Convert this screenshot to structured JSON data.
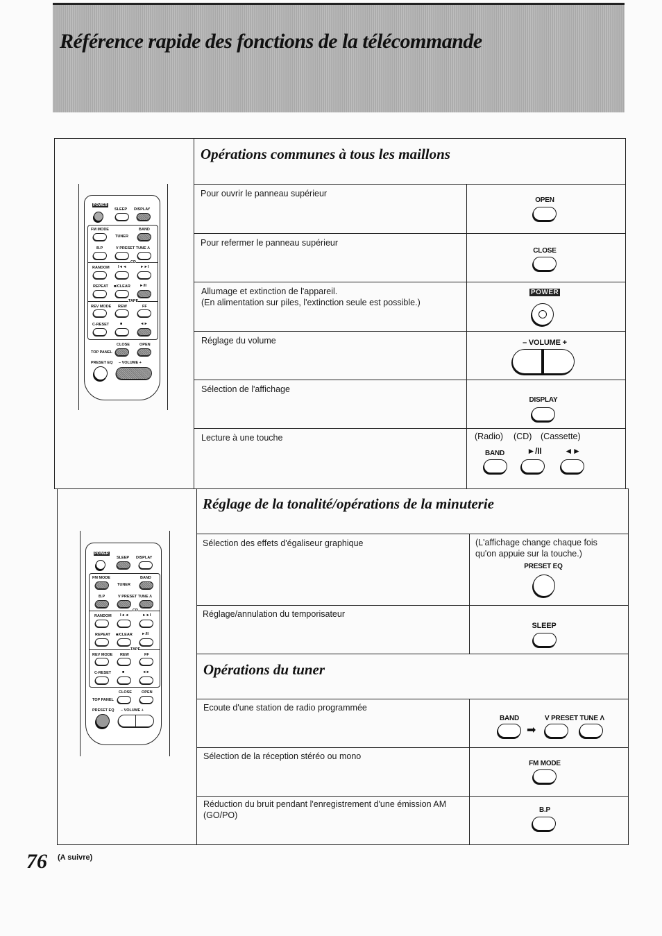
{
  "page_title": "Référence rapide des fonctions de la télécommande",
  "page_number": "76",
  "continued_label": "(A suivre)",
  "remote": {
    "power": "POWER",
    "sleep": "SLEEP",
    "display": "DISPLAY",
    "fm_mode": "FM MODE",
    "band": "BAND",
    "tuner": "TUNER",
    "bp": "B.P",
    "preset_tune": "V PRESET TUNE Λ",
    "cd": "CD",
    "random": "RANDOM",
    "prev": "I◄◄",
    "next": "►►I",
    "repeat": "REPEAT",
    "stop_clear": "■/CLEAR",
    "play_pause": "►/II",
    "tape": "TAPE",
    "rev_mode": "REV MODE",
    "rew": "REW",
    "ff": "FF",
    "c_reset": "C-RESET",
    "stop": "■",
    "tape_play": "◄►",
    "close": "CLOSE",
    "open": "OPEN",
    "top_panel": "TOP PANEL",
    "preset_eq": "PRESET EQ",
    "volume": "– VOLUME +"
  },
  "sections": [
    {
      "title": "Opérations communes à tous les maillons",
      "rows": [
        {
          "description": "Pour ouvrir le panneau supérieur",
          "buttons": [
            "OPEN"
          ]
        },
        {
          "description": "Pour refermer le panneau supérieur",
          "buttons": [
            "CLOSE"
          ]
        },
        {
          "description": "Allumage et extinction de l'appareil.",
          "description2": "(En alimentation sur piles, l'extinction seule est possible.)",
          "buttons": [
            "POWER"
          ]
        },
        {
          "description": "Réglage du volume",
          "buttons": [
            "– VOLUME +"
          ]
        },
        {
          "description": "Sélection de l'affichage",
          "buttons": [
            "DISPLAY"
          ]
        },
        {
          "description": "Lecture à une touche",
          "modes": [
            "(Radio)",
            "(CD)",
            "(Cassette)"
          ],
          "buttons": [
            "BAND",
            "►/II",
            "◄►"
          ]
        }
      ]
    },
    {
      "title": "Réglage de la tonalité/opérations de la minuterie",
      "rows": [
        {
          "description": "Sélection des effets d'égaliseur graphique",
          "note1": "(L'affichage change chaque fois",
          "note2": "qu'on appuie sur la touche.)",
          "buttons": [
            "PRESET EQ"
          ]
        },
        {
          "description": "Réglage/annulation du temporisateur",
          "buttons": [
            "SLEEP"
          ]
        }
      ]
    },
    {
      "title": "Opérations du tuner",
      "rows": [
        {
          "description": "Ecoute d'une station de radio programmée",
          "buttons": [
            "BAND",
            "V PRESET TUNE Λ"
          ]
        },
        {
          "description": "Sélection de la réception stéréo ou mono",
          "buttons": [
            "FM MODE"
          ]
        },
        {
          "description": "Réduction du bruit pendant l'enregistrement d'une émission AM",
          "description2": "(GO/PO)",
          "buttons": [
            "B.P"
          ]
        }
      ]
    }
  ]
}
